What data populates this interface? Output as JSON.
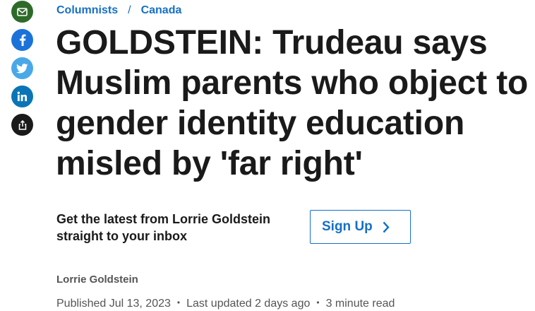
{
  "share": {
    "buttons": [
      {
        "name": "email",
        "color": "#2e6b2a"
      },
      {
        "name": "facebook",
        "color": "#1b73d9"
      },
      {
        "name": "twitter",
        "color": "#4aa8e8"
      },
      {
        "name": "linkedin",
        "color": "#0a75b6"
      },
      {
        "name": "share",
        "color": "#1a1a1a"
      }
    ]
  },
  "breadcrumb": {
    "items": [
      "Columnists",
      "Canada"
    ],
    "separator": "/"
  },
  "article": {
    "headline": "GOLDSTEIN: Trudeau says Muslim parents who object to gender identity education misled by 'far right'",
    "author": "Lorrie Goldstein",
    "published": "Published Jul 13, 2023",
    "updated": "Last updated 2 days ago",
    "read_time": "3 minute read",
    "meta_separator": "•"
  },
  "newsletter": {
    "text": "Get the latest from Lorrie Goldstein straight to your inbox",
    "button_label": "Sign Up"
  },
  "colors": {
    "link_blue": "#1570c7",
    "text_dark": "#1a1a1a",
    "text_muted": "#555555"
  }
}
